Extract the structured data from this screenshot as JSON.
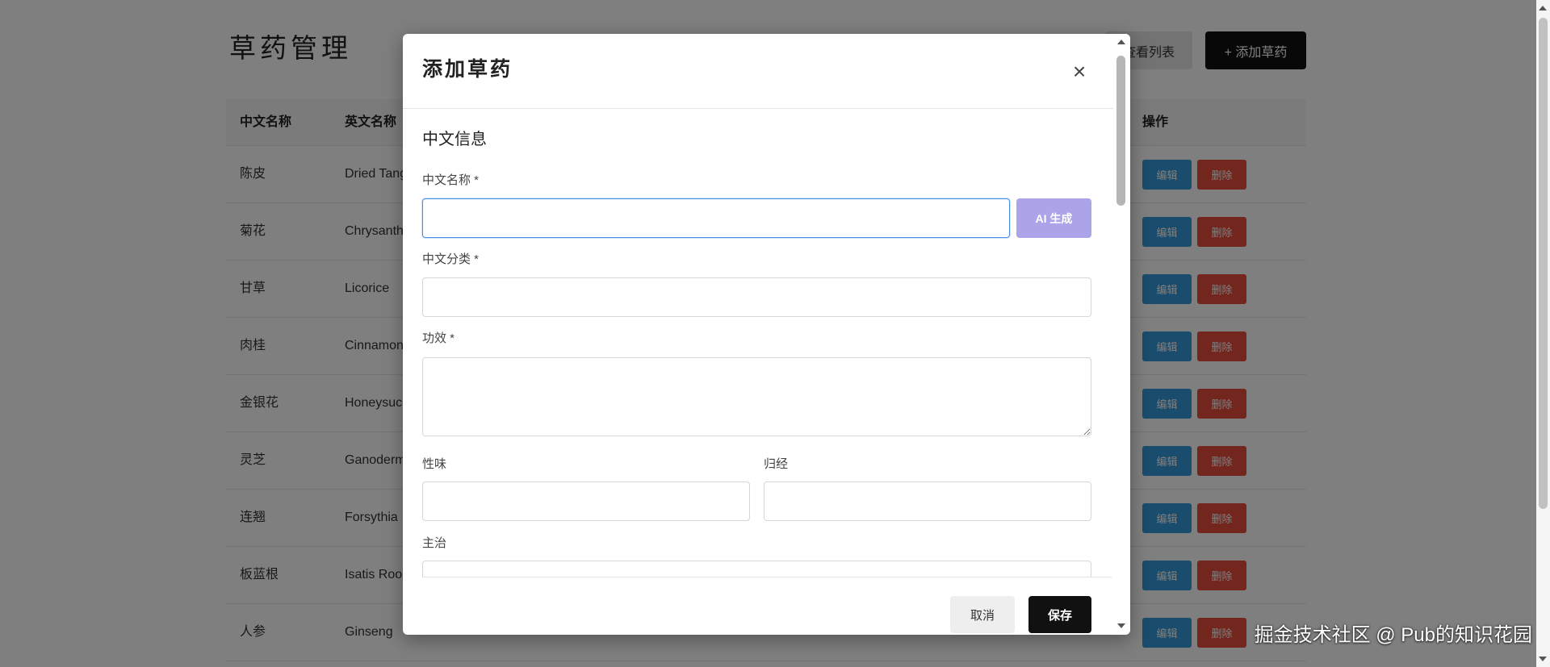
{
  "page": {
    "title": "草药管理",
    "view_list_button": "查看列表",
    "add_button": "+ 添加草药"
  },
  "table": {
    "headers": {
      "cn_name": "中文名称",
      "en_name": "英文名称",
      "actions": "操作"
    },
    "row_actions": {
      "edit": "编辑",
      "delete": "删除"
    },
    "rows": [
      {
        "cn": "陈皮",
        "en": "Dried Tang"
      },
      {
        "cn": "菊花",
        "en": "Chrysanth"
      },
      {
        "cn": "甘草",
        "en": "Licorice"
      },
      {
        "cn": "肉桂",
        "en": "Cinnamon"
      },
      {
        "cn": "金银花",
        "en": "Honeysuc"
      },
      {
        "cn": "灵芝",
        "en": "Ganoderm"
      },
      {
        "cn": "连翘",
        "en": "Forsythia"
      },
      {
        "cn": "板蓝根",
        "en": "Isatis Roo"
      },
      {
        "cn": "人参",
        "en": "Ginseng"
      }
    ]
  },
  "modal": {
    "title": "添加草药",
    "close_glyph": "×",
    "section_title": "中文信息",
    "fields": {
      "cn_name": {
        "label": "中文名称 *",
        "value": ""
      },
      "cn_category": {
        "label": "中文分类 *",
        "value": ""
      },
      "efficacy": {
        "label": "功效 *",
        "value": ""
      },
      "nature_flavor": {
        "label": "性味",
        "value": ""
      },
      "meridian": {
        "label": "归经",
        "value": ""
      },
      "indications": {
        "label": "主治",
        "value": ""
      }
    },
    "ai_button": "AI 生成",
    "cancel_button": "取消",
    "save_button": "保存"
  },
  "watermark": "掘金技术社区 @ Pub的知识花园",
  "colors": {
    "edit_button": "#3498db",
    "delete_button": "#e74c3c",
    "primary_button": "#111111",
    "ai_button": "#aba4e8",
    "focus_border": "#4a90e2"
  }
}
